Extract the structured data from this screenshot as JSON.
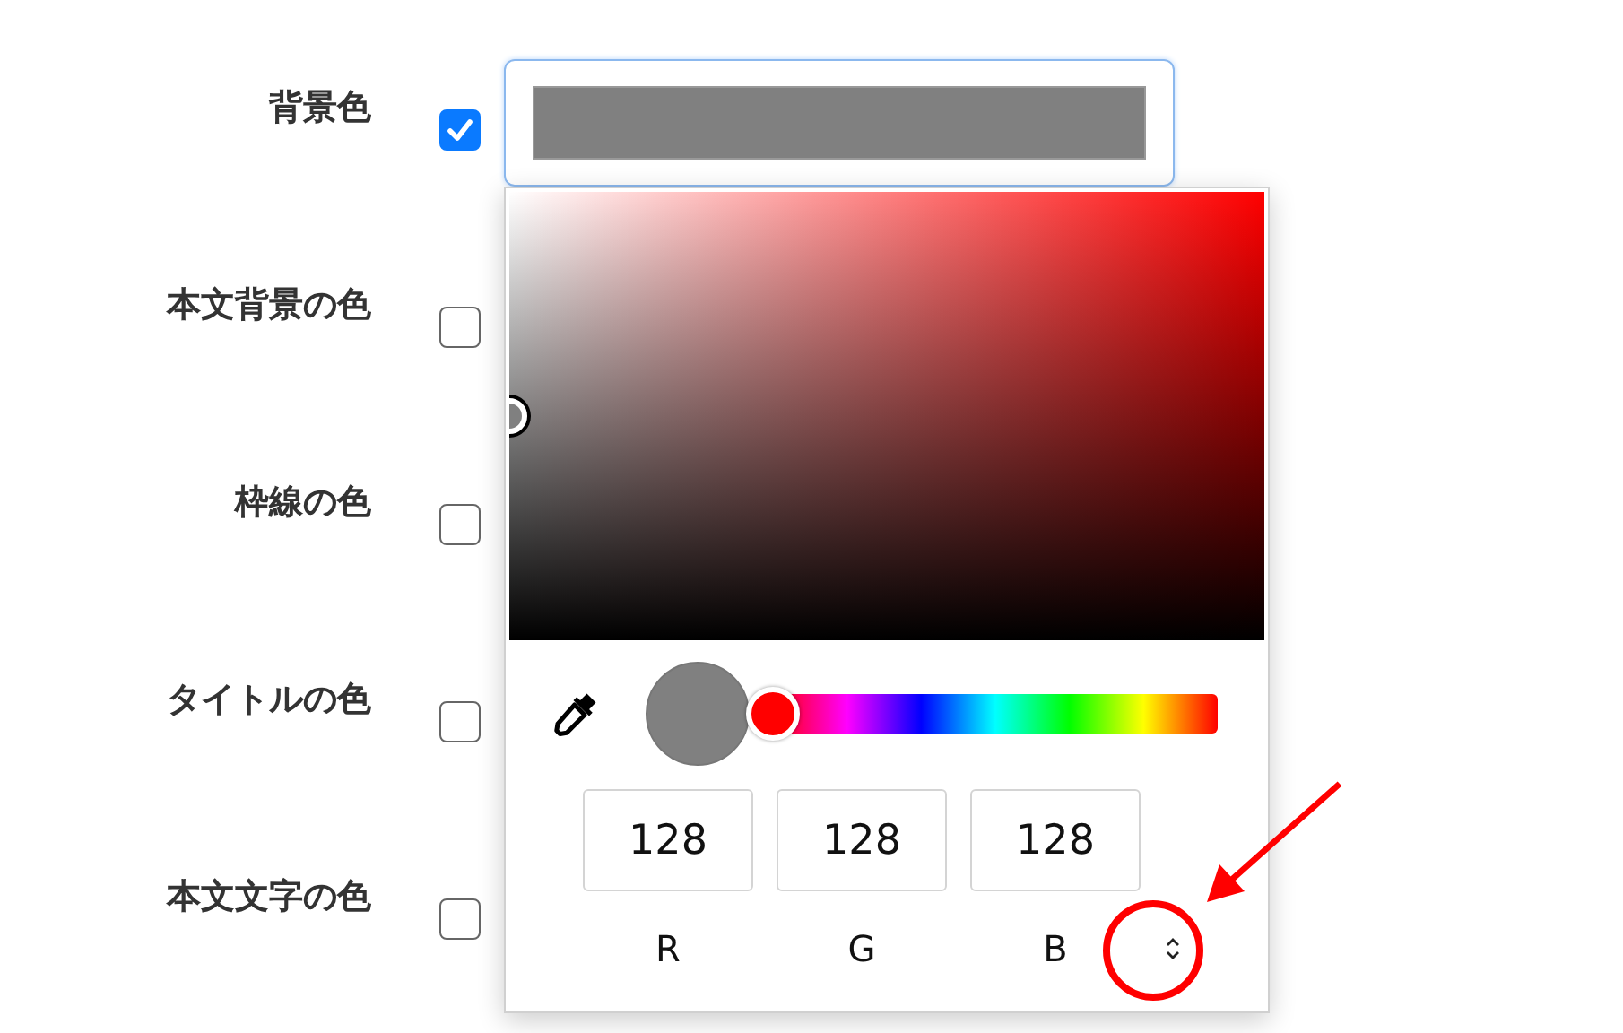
{
  "fields": [
    {
      "kind": "swatch",
      "label": "背景色",
      "checked": true
    },
    {
      "kind": "plain",
      "label": "本文背景の色",
      "checked": false
    },
    {
      "kind": "plain",
      "label": "枠線の色",
      "checked": false
    },
    {
      "kind": "plain",
      "label": "タイトルの色",
      "checked": false
    },
    {
      "kind": "plain",
      "label": "本文文字の色",
      "checked": false
    }
  ],
  "color_picker": {
    "hue_slider": {
      "level": 0
    },
    "channels": [
      {
        "label": "R",
        "value": "128"
      },
      {
        "label": "G",
        "value": "128"
      },
      {
        "label": "B",
        "value": "128"
      }
    ]
  }
}
